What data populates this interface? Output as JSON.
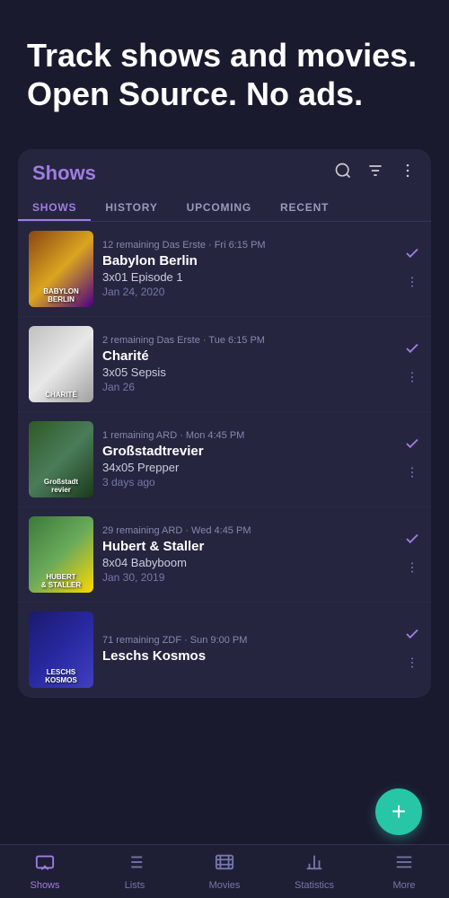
{
  "hero": {
    "title": "Track shows and movies. Open Source. No ads."
  },
  "card": {
    "title": "Shows",
    "tabs": [
      {
        "label": "SHOWS",
        "active": true
      },
      {
        "label": "HISTORY",
        "active": false
      },
      {
        "label": "UPCOMING",
        "active": false
      },
      {
        "label": "RECENT",
        "active": false
      }
    ],
    "shows": [
      {
        "id": 1,
        "name": "Babylon Berlin",
        "episode": "3x01 Episode 1",
        "date": "Jan 24, 2020",
        "remaining": "12 remaining",
        "network": "Das Erste",
        "airtime": "Fri 6:15 PM",
        "posterClass": "poster-babylon",
        "posterText": "BABYLON\nBERLIN"
      },
      {
        "id": 2,
        "name": "Charité",
        "episode": "3x05 Sepsis",
        "date": "Jan 26",
        "remaining": "2 remaining",
        "network": "Das Erste",
        "airtime": "Tue 6:15 PM",
        "posterClass": "poster-charite",
        "posterText": "CHARITÉ"
      },
      {
        "id": 3,
        "name": "Großstadtrevier",
        "episode": "34x05 Prepper",
        "date": "3 days ago",
        "remaining": "1 remaining",
        "network": "ARD",
        "airtime": "Mon 4:45 PM",
        "posterClass": "poster-grossstadt",
        "posterText": "Großstadt\nrevier"
      },
      {
        "id": 4,
        "name": "Hubert & Staller",
        "episode": "8x04 Babyboom",
        "date": "Jan 30, 2019",
        "remaining": "29 remaining",
        "network": "ARD",
        "airtime": "Wed 4:45 PM",
        "posterClass": "poster-hubert",
        "posterText": "HUBERT\n& STALLER"
      },
      {
        "id": 5,
        "name": "Leschs Kosmos",
        "episode": "",
        "date": "",
        "remaining": "71 remaining",
        "network": "ZDF",
        "airtime": "Sun 9:00 PM",
        "posterClass": "poster-leschs",
        "posterText": "LESCHS\nKOSMOS"
      }
    ]
  },
  "fab": {
    "label": "+"
  },
  "bottomNav": [
    {
      "id": "shows",
      "label": "Shows",
      "icon": "tv",
      "active": true
    },
    {
      "id": "lists",
      "label": "Lists",
      "icon": "list",
      "active": false
    },
    {
      "id": "movies",
      "label": "Movies",
      "icon": "movie",
      "active": false
    },
    {
      "id": "statistics",
      "label": "Statistics",
      "icon": "stats",
      "active": false
    },
    {
      "id": "more",
      "label": "More",
      "icon": "more",
      "active": false
    }
  ]
}
